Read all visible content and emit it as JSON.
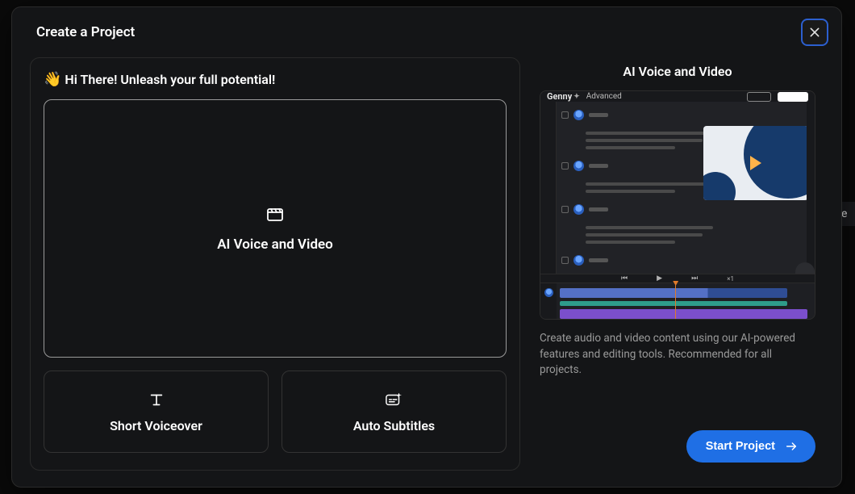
{
  "backdrop": {
    "peek_text": "tle"
  },
  "modal": {
    "title": "Create a Project",
    "greeting_emoji": "👋",
    "greeting_text": "Hi There! Unleash your full potential!",
    "options": {
      "primary": {
        "label": "AI Voice and Video",
        "selected": true
      },
      "secondary": [
        {
          "label": "Short Voiceover"
        },
        {
          "label": "Auto Subtitles"
        }
      ]
    },
    "details": {
      "title": "AI Voice and Video",
      "preview": {
        "brand": "Genny",
        "mode": "Advanced",
        "playback_rate": "×1"
      },
      "description": "Create audio and video content using our AI-powered features and editing tools. Recommended for all projects.",
      "cta": "Start Project"
    }
  }
}
